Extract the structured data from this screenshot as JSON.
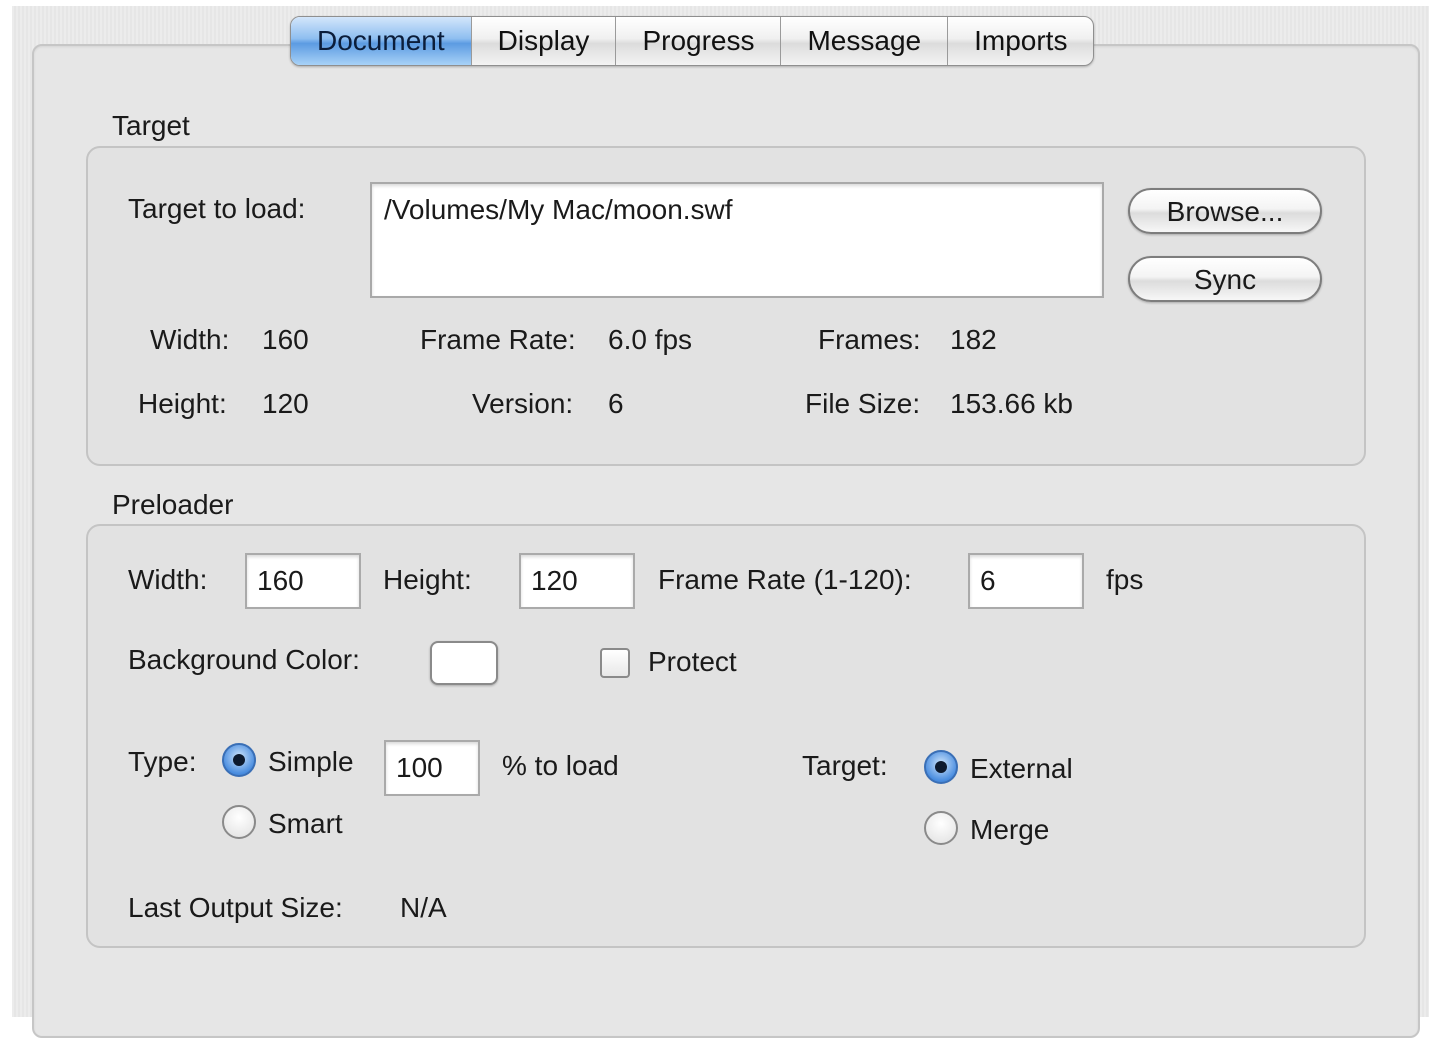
{
  "tabs": [
    "Document",
    "Display",
    "Progress",
    "Message",
    "Imports"
  ],
  "active_tab": "Document",
  "target": {
    "title": "Target",
    "target_to_load_label": "Target to load:",
    "path": "/Volumes/My Mac/moon.swf",
    "browse_label": "Browse...",
    "sync_label": "Sync",
    "width_label": "Width:",
    "width_value": "160",
    "height_label": "Height:",
    "height_value": "120",
    "frame_rate_label": "Frame Rate:",
    "frame_rate_value": "6.0 fps",
    "version_label": "Version:",
    "version_value": "6",
    "frames_label": "Frames:",
    "frames_value": "182",
    "file_size_label": "File Size:",
    "file_size_value": "153.66 kb"
  },
  "preloader": {
    "title": "Preloader",
    "width_label": "Width:",
    "width_value": "160",
    "height_label": "Height:",
    "height_value": "120",
    "frame_rate_label": "Frame Rate (1-120):",
    "frame_rate_value": "6",
    "fps_label": "fps",
    "bg_color_label": "Background Color:",
    "bg_color": "#ffffff",
    "protect_label": "Protect",
    "protect_checked": false,
    "type_label": "Type:",
    "type_simple_label": "Simple",
    "type_smart_label": "Smart",
    "type_selected": "Simple",
    "percent_value": "100",
    "percent_label": "% to load",
    "target_label": "Target:",
    "target_external_label": "External",
    "target_merge_label": "Merge",
    "target_selected": "External",
    "last_output_label": "Last Output Size:",
    "last_output_value": "N/A"
  },
  "colors": {
    "active_tab_accent": "#5c9be2",
    "panel_background": "#e6e6e6"
  }
}
